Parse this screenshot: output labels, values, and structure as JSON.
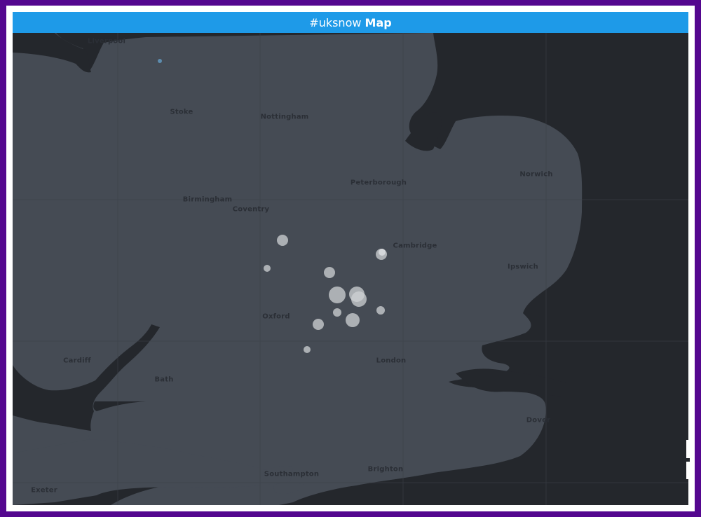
{
  "header": {
    "hashtag": "#uksnow",
    "title_strong": "Map"
  },
  "map": {
    "cities": [
      {
        "id": "liverpool",
        "name": "Liverpool"
      },
      {
        "id": "stoke",
        "name": "Stoke"
      },
      {
        "id": "nottingham",
        "name": "Nottingham"
      },
      {
        "id": "peterborough",
        "name": "Peterborough"
      },
      {
        "id": "norwich",
        "name": "Norwich"
      },
      {
        "id": "birmingham",
        "name": "Birmingham"
      },
      {
        "id": "coventry",
        "name": "Coventry"
      },
      {
        "id": "cambridge",
        "name": "Cambridge"
      },
      {
        "id": "ipswich",
        "name": "Ipswich"
      },
      {
        "id": "oxford",
        "name": "Oxford"
      },
      {
        "id": "cardiff",
        "name": "Cardiff"
      },
      {
        "id": "london",
        "name": "London"
      },
      {
        "id": "bath",
        "name": "Bath"
      },
      {
        "id": "dover",
        "name": "Dover"
      },
      {
        "id": "brighton",
        "name": "Brighton"
      },
      {
        "id": "southampton",
        "name": "Southampton"
      },
      {
        "id": "exeter",
        "name": "Exeter"
      }
    ],
    "colors": {
      "land": "#454b54",
      "sea": "#24272c",
      "marker": "#cfd1d4",
      "marker_accent": "#5f93b8",
      "header": "#1e9ae8",
      "border": "#54078f"
    }
  }
}
